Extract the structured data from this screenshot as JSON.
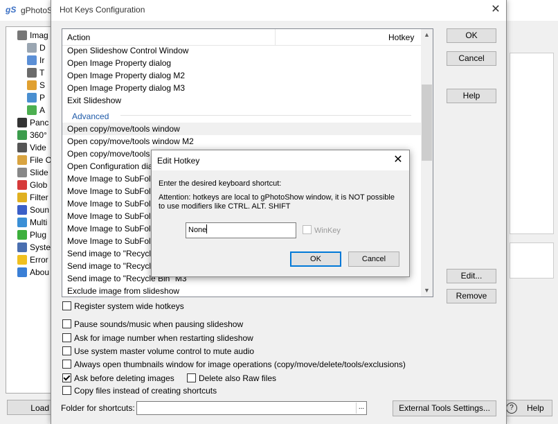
{
  "main_window": {
    "app_logo": "gS",
    "title": "gPhotoS",
    "tree_items": [
      {
        "label": "Imag",
        "icon": "camera-icon",
        "indent": 0,
        "color": "#777777"
      },
      {
        "label": "D",
        "icon": "trash-icon",
        "indent": 1,
        "color": "#9aa6b2"
      },
      {
        "label": "Ir",
        "icon": "image-icon",
        "indent": 1,
        "color": "#5b8fd6"
      },
      {
        "label": "T",
        "icon": "text-icon",
        "indent": 1,
        "color": "#6b6b6b"
      },
      {
        "label": "S",
        "icon": "slideshow-icon",
        "indent": 1,
        "color": "#e0a030"
      },
      {
        "label": "P",
        "icon": "panel-icon",
        "indent": 1,
        "color": "#4a8fd0"
      },
      {
        "label": "A",
        "icon": "folder-green-icon",
        "indent": 1,
        "color": "#4caf50"
      },
      {
        "label": "Panc",
        "icon": "film-icon",
        "indent": 0,
        "color": "#333333"
      },
      {
        "label": "360°",
        "icon": "globe-360-icon",
        "indent": 0,
        "color": "#3c9c4c"
      },
      {
        "label": "Vide",
        "icon": "video-icon",
        "indent": 0,
        "color": "#555555"
      },
      {
        "label": "File C",
        "icon": "file-icon",
        "indent": 0,
        "color": "#d9a441"
      },
      {
        "label": "Slide",
        "icon": "tools-icon",
        "indent": 0,
        "color": "#888888"
      },
      {
        "label": "Glob",
        "icon": "stop-icon",
        "indent": 0,
        "color": "#d63a3a"
      },
      {
        "label": "Filter",
        "icon": "filter-icon",
        "indent": 0,
        "color": "#e0b020"
      },
      {
        "label": "Soun",
        "icon": "music-icon",
        "indent": 0,
        "color": "#3a5fc8"
      },
      {
        "label": "Multi",
        "icon": "monitors-icon",
        "indent": 0,
        "color": "#3a8fd6"
      },
      {
        "label": "Plug",
        "icon": "puzzle-icon",
        "indent": 0,
        "color": "#3caf3c"
      },
      {
        "label": "Syste",
        "icon": "system-icon",
        "indent": 0,
        "color": "#4a6fb0"
      },
      {
        "label": "Error",
        "icon": "warning-icon",
        "indent": 0,
        "color": "#f0c020"
      },
      {
        "label": "Abou",
        "icon": "info-icon",
        "indent": 0,
        "color": "#3a7fd6"
      }
    ],
    "load_label": "Load",
    "help_label": "Help"
  },
  "hotkeys_dialog": {
    "title": "Hot Keys Configuration",
    "columns": {
      "action": "Action",
      "hotkey": "Hotkey"
    },
    "rows_before_group": [
      "Open Slideshow Control Window",
      "Open Image Property dialog",
      "Open Image Property dialog M2",
      "Open Image Property dialog M3",
      "Exit Slideshow"
    ],
    "group_label": "Advanced",
    "rows_after_group": [
      "Open copy/move/tools window",
      "Open copy/move/tools window M2",
      "Open copy/move/tools wi",
      "Open Configuration dialog",
      "Move Image to SubFolder",
      "Move Image to SubFolder",
      "Move Image to SubFolder",
      "Move Image to SubFolder",
      "Move Image to SubFolder",
      "Move Image to SubFolder",
      "Send image to \"Recycle Bi",
      "Send image to \"Recycle Bi",
      "Send image to \"Recycle Bin\" M3",
      "Exclude image from slideshow"
    ],
    "buttons": {
      "ok": "OK",
      "cancel": "Cancel",
      "help": "Help",
      "edit": "Edit...",
      "remove": "Remove"
    },
    "options": [
      {
        "label": "Register system wide hotkeys",
        "checked": false
      },
      {
        "label": "Pause sounds/music when pausing slideshow",
        "checked": false
      },
      {
        "label": "Ask for image number when restarting slideshow",
        "checked": false
      },
      {
        "label": "Use system master volume control to mute audio",
        "checked": false
      },
      {
        "label": "Always open thumbnails window for image operations (copy/move/delete/tools/exclusions)",
        "checked": false
      },
      {
        "label": "Ask before deleting images",
        "checked": true
      },
      {
        "label": "Copy files instead of creating shortcuts",
        "checked": false
      }
    ],
    "delete_raw": {
      "label": "Delete also Raw files",
      "checked": false
    },
    "folder_label": "Folder for shortcuts:",
    "folder_value": "",
    "browse_label": "...",
    "external_tools_label": "External Tools Settings..."
  },
  "edit_hotkey_dialog": {
    "title": "Edit Hotkey",
    "prompt": "Enter the desired keyboard shortcut:",
    "warning": "Attention: hotkeys are local to gPhotoShow window, it is NOT possible to use modifiers like CTRL. ALT. SHIFT",
    "input_value": "None",
    "winkey_label": "WinKey",
    "winkey_checked": false,
    "ok_label": "OK",
    "cancel_label": "Cancel"
  }
}
